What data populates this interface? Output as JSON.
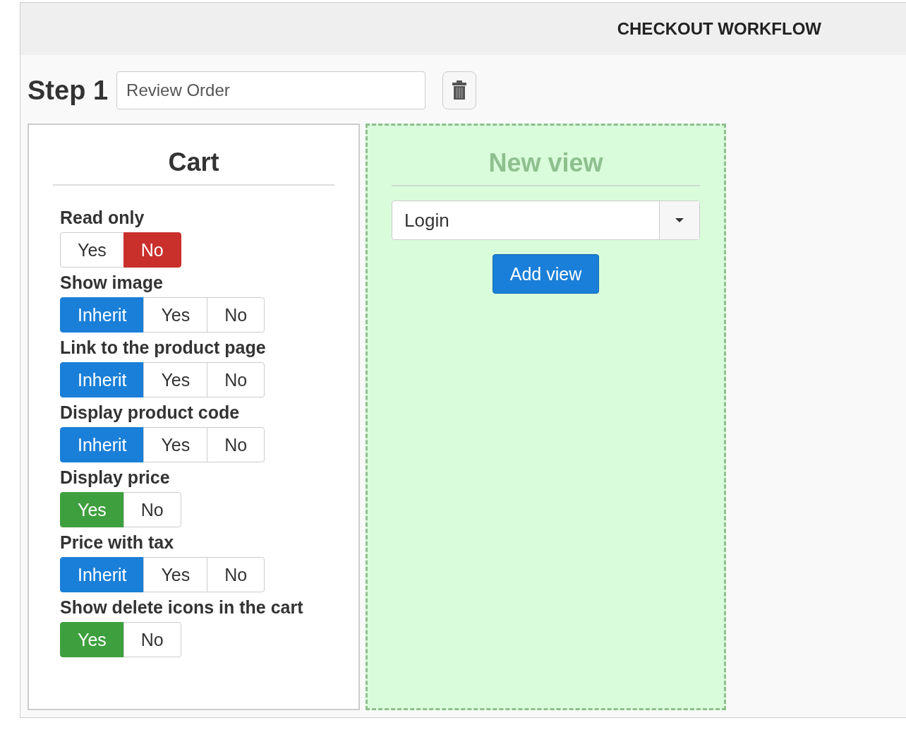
{
  "header": {
    "title": "CHECKOUT WORKFLOW"
  },
  "step": {
    "label": "Step 1",
    "name_value": "Review Order"
  },
  "cart": {
    "title": "Cart",
    "settings": [
      {
        "label": "Read only",
        "options": [
          {
            "label": "Yes",
            "selected": false
          },
          {
            "label": "No",
            "selected": true,
            "color": "#c9302c"
          }
        ]
      },
      {
        "label": "Show image",
        "options": [
          {
            "label": "Inherit",
            "selected": true,
            "color": "#1a7fd8"
          },
          {
            "label": "Yes",
            "selected": false
          },
          {
            "label": "No",
            "selected": false
          }
        ]
      },
      {
        "label": "Link to the product page",
        "options": [
          {
            "label": "Inherit",
            "selected": true,
            "color": "#1a7fd8"
          },
          {
            "label": "Yes",
            "selected": false
          },
          {
            "label": "No",
            "selected": false
          }
        ]
      },
      {
        "label": "Display product code",
        "options": [
          {
            "label": "Inherit",
            "selected": true,
            "color": "#1a7fd8"
          },
          {
            "label": "Yes",
            "selected": false
          },
          {
            "label": "No",
            "selected": false
          }
        ]
      },
      {
        "label": "Display price",
        "options": [
          {
            "label": "Yes",
            "selected": true,
            "color": "#3e9f3e"
          },
          {
            "label": "No",
            "selected": false
          }
        ]
      },
      {
        "label": "Price with tax",
        "options": [
          {
            "label": "Inherit",
            "selected": true,
            "color": "#1a7fd8"
          },
          {
            "label": "Yes",
            "selected": false
          },
          {
            "label": "No",
            "selected": false
          }
        ]
      },
      {
        "label": "Show delete icons in the cart",
        "options": [
          {
            "label": "Yes",
            "selected": true,
            "color": "#3e9f3e"
          },
          {
            "label": "No",
            "selected": false
          }
        ]
      }
    ]
  },
  "new_view": {
    "title": "New view",
    "select_value": "Login",
    "button": "Add view"
  }
}
